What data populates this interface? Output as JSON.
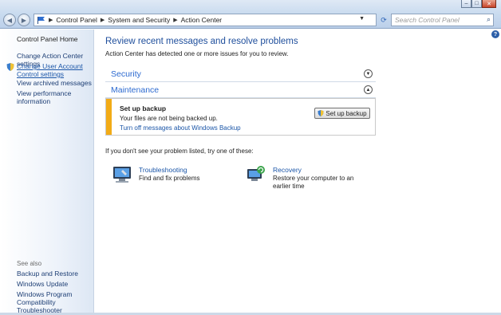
{
  "address_bar": {
    "crumbs": [
      "Control Panel",
      "System and Security",
      "Action Center"
    ],
    "search_placeholder": "Search Control Panel"
  },
  "left_pane": {
    "home": "Control Panel Home",
    "links": [
      "Change Action Center settings",
      "Change User Account Control settings",
      "View archived messages",
      "View performance information"
    ],
    "see_also_label": "See also",
    "see_also": [
      "Backup and Restore",
      "Windows Update",
      "Windows Program Compatibility Troubleshooter"
    ]
  },
  "main": {
    "heading": "Review recent messages and resolve problems",
    "subheading": "Action Center has detected one or more issues for you to review.",
    "sections": [
      "Security",
      "Maintenance"
    ],
    "alert": {
      "title": "Set up backup",
      "message": "Your files are not being backed up.",
      "link": "Turn off messages about Windows Backup",
      "button": "Set up backup",
      "accent": "#f2ab16"
    },
    "not_listed": "If you don't see your problem listed, try one of these:",
    "tools": [
      {
        "name": "Troubleshooting",
        "desc": "Find and fix problems",
        "icon": "troubleshooting-icon"
      },
      {
        "name": "Recovery",
        "desc": "Restore your computer to an earlier time",
        "icon": "recovery-icon"
      }
    ]
  },
  "colors": {
    "heading": "#1e4e9c",
    "link": "#1b56a8",
    "section": "#2c6ad0"
  }
}
